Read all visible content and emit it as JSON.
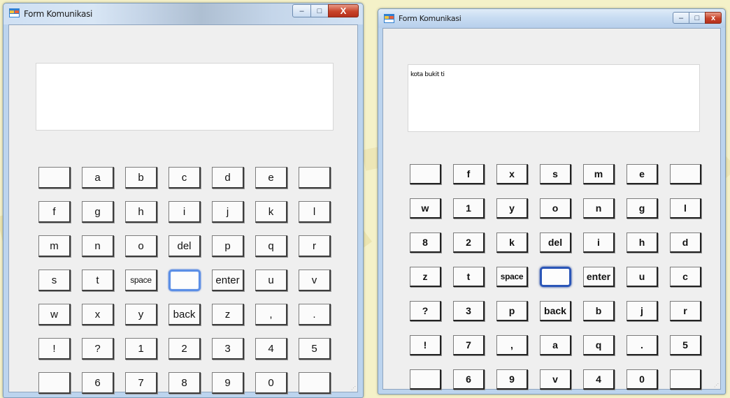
{
  "left": {
    "title": "Form Komunikasi",
    "controls": {
      "minimize": "–",
      "maximize": "□",
      "close": "X"
    },
    "textbox_value": "",
    "keys": [
      [
        "",
        "a",
        "b",
        "c",
        "d",
        "e",
        ""
      ],
      [
        "f",
        "g",
        "h",
        "i",
        "j",
        "k",
        "l"
      ],
      [
        "m",
        "n",
        "o",
        "del",
        "p",
        "q",
        "r"
      ],
      [
        "s",
        "t",
        "space",
        "",
        "enter",
        "u",
        "v"
      ],
      [
        "w",
        "x",
        "y",
        "back",
        "z",
        ",",
        "."
      ],
      [
        "!",
        "?",
        "1",
        "2",
        "3",
        "4",
        "5"
      ],
      [
        "",
        "6",
        "7",
        "8",
        "9",
        "0",
        ""
      ]
    ],
    "focused_key": "row-3-col-3"
  },
  "right": {
    "title": "Form Komunikasi",
    "controls": {
      "minimize": "–",
      "maximize": "□",
      "close": "x"
    },
    "textbox_value": "kota bukit ti",
    "keys": [
      [
        "",
        "f",
        "x",
        "s",
        "m",
        "e",
        ""
      ],
      [
        "w",
        "1",
        "y",
        "o",
        "n",
        "g",
        "l"
      ],
      [
        "8",
        "2",
        "k",
        "del",
        "i",
        "h",
        "d"
      ],
      [
        "z",
        "t",
        "space",
        "",
        "enter",
        "u",
        "c"
      ],
      [
        "?",
        "3",
        "p",
        "back",
        "b",
        "j",
        "r"
      ],
      [
        "!",
        "7",
        ",",
        "a",
        "q",
        ".",
        "5"
      ],
      [
        "",
        "6",
        "9",
        "v",
        "4",
        "0",
        ""
      ]
    ],
    "focused_key": "row-3-col-3"
  },
  "icons": {
    "app": "form-app-icon",
    "grip": "resize-grip-icon"
  },
  "colors": {
    "focus_ring": "#5b8ee6",
    "close_button": "#c8432a",
    "page_background": "#f4f1c8"
  }
}
